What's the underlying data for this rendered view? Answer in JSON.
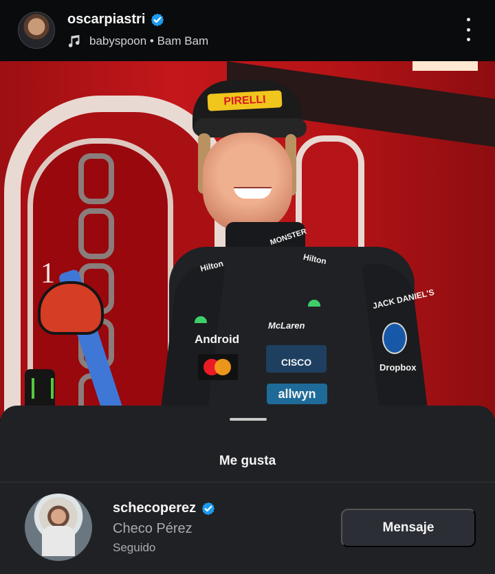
{
  "header": {
    "username": "oscarpiastri",
    "music": "babyspoon • Bam Bam"
  },
  "photo": {
    "logos": {
      "pirelli": "PIRELLI",
      "android": "Android",
      "mclaren": "McLaren",
      "cisco": "CISCO",
      "allwyn": "allwyn",
      "hilton": "Hilton",
      "monster": "MONSTER",
      "jack": "JACK DANIEL'S",
      "dropbox": "Dropbox",
      "number": "1"
    }
  },
  "likes_sheet": {
    "title": "Me gusta",
    "users": [
      {
        "username": "schecoperez",
        "full_name": "Checo Pérez",
        "status": "Seguido",
        "button_label": "Mensaje"
      }
    ]
  },
  "colors": {
    "verified": "#1d9bf0",
    "sheet": "#202124",
    "button": "#2b2f35"
  }
}
